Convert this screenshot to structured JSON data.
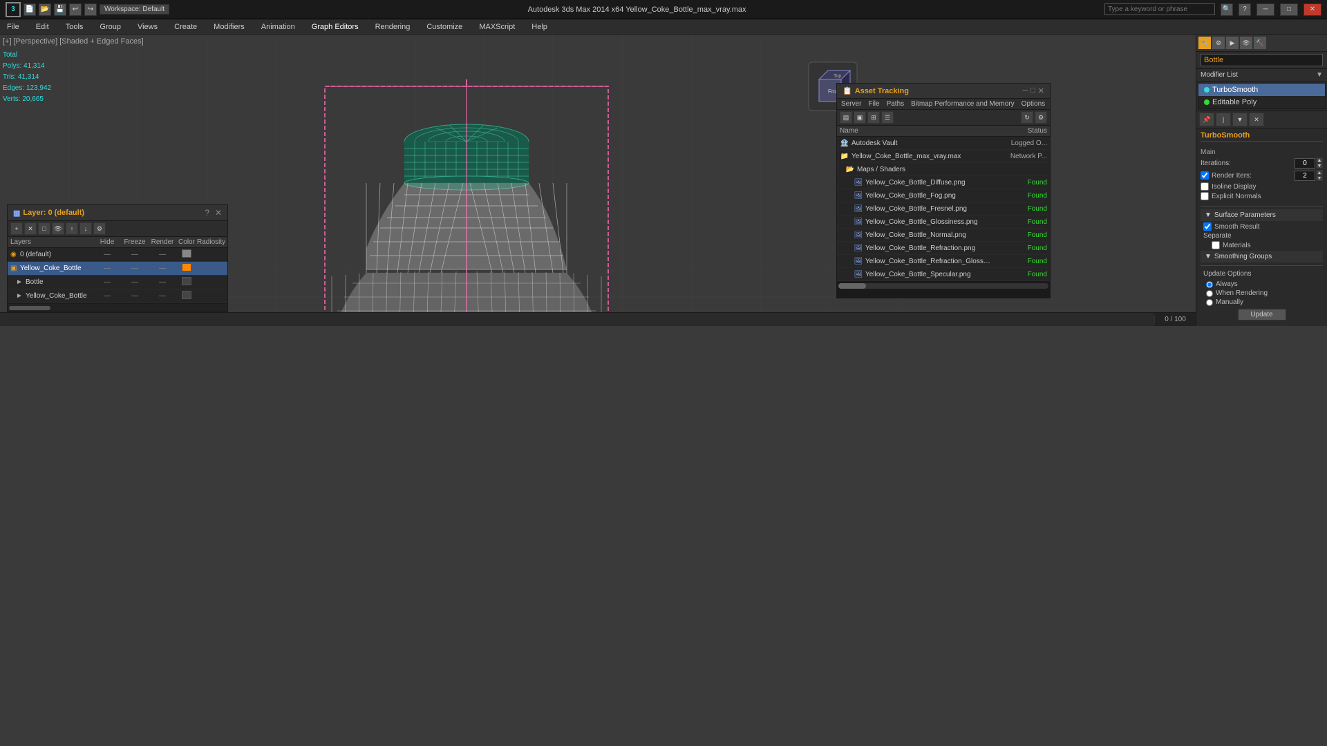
{
  "app": {
    "title": "Autodesk 3ds Max 2014 x64 — Yellow_Coke_Bottle_max_vray.max",
    "logo": "3",
    "workspace": "Workspace: Default"
  },
  "titlebar": {
    "undo": "↩",
    "redo": "↪",
    "window_title": "Autodesk 3ds Max 2014 x64   Yellow_Coke_Bottle_max_vray.max",
    "minimize": "─",
    "maximize": "□",
    "close": "✕"
  },
  "menubar": {
    "items": [
      "File",
      "Edit",
      "Tools",
      "Group",
      "Views",
      "Create",
      "Modifiers",
      "Animation",
      "Graph Editors",
      "Rendering",
      "Customize",
      "MAXScript",
      "Help"
    ]
  },
  "toolbar": {
    "workspace_label": "Workspace: Default"
  },
  "viewport": {
    "label": "[+] [Perspective] [Shaded + Edged Faces]",
    "stats": {
      "total_label": "Total",
      "polys_label": "Polys:",
      "polys_val": "41,314",
      "tris_label": "Tris:",
      "tris_val": "41,314",
      "edges_label": "Edges:",
      "edges_val": "123,942",
      "verts_label": "Verts:",
      "verts_val": "20,665"
    }
  },
  "modifier_panel": {
    "object_name": "Bottle",
    "modifier_list_label": "Modifier List",
    "modifiers": [
      {
        "name": "TurboSmooth",
        "selected": true
      },
      {
        "name": "Editable Poly",
        "selected": false
      }
    ],
    "turbosmooth": {
      "title": "TurboSmooth",
      "main_label": "Main",
      "iterations_label": "Iterations:",
      "iterations_val": "0",
      "render_iters_label": "Render Iters:",
      "render_iters_val": "2",
      "isoline_display_label": "Isoline Display",
      "isoline_display_checked": false,
      "explicit_normals_label": "Explicit Normals",
      "explicit_normals_checked": false,
      "surface_params_label": "Surface Parameters",
      "smooth_result_label": "Smooth Result",
      "smooth_result_checked": true,
      "separate_label": "Separate",
      "materials_label": "Materials",
      "materials_checked": false,
      "smoothing_groups_label": "Smoothing Groups",
      "smoothing_groups_checked": false,
      "update_options_label": "Update Options",
      "always_label": "Always",
      "always_checked": true,
      "when_rendering_label": "When Rendering",
      "when_rendering_checked": false,
      "manually_label": "Manually",
      "manually_checked": false,
      "update_btn": "Update"
    }
  },
  "layers": {
    "title": "Layer: 0 (default)",
    "panel_title": "Layers",
    "columns": [
      "Layers",
      "Hide",
      "Freeze",
      "Render",
      "Color",
      "Radiosity"
    ],
    "items": [
      {
        "indent": 0,
        "name": "0 (default)",
        "hide": "—",
        "freeze": "—",
        "render": "—",
        "color": "#888888",
        "selected": false
      },
      {
        "indent": 1,
        "name": "Yellow_Coke_Bottle",
        "hide": "—",
        "freeze": "—",
        "render": "—",
        "color": "#ff8800",
        "selected": true
      },
      {
        "indent": 2,
        "name": "Bottle",
        "hide": "—",
        "freeze": "—",
        "render": "—",
        "color": "#444444",
        "selected": false
      },
      {
        "indent": 2,
        "name": "Yellow_Coke_Bottle",
        "hide": "—",
        "freeze": "—",
        "render": "—",
        "color": "#444444",
        "selected": false
      }
    ]
  },
  "asset_tracking": {
    "title": "Asset Tracking",
    "menu": [
      "Server",
      "File",
      "Paths",
      "Bitmap Performance and Memory",
      "Options"
    ],
    "columns": [
      "Name",
      "Status"
    ],
    "items": [
      {
        "indent": 0,
        "type": "vault",
        "name": "Autodesk Vault",
        "status": "Logged O...",
        "status_type": "network"
      },
      {
        "indent": 0,
        "type": "file",
        "name": "Yellow_Coke_Bottle_max_vray.max",
        "status": "Network P...",
        "status_type": "network"
      },
      {
        "indent": 1,
        "type": "folder",
        "name": "Maps / Shaders",
        "status": "",
        "status_type": ""
      },
      {
        "indent": 2,
        "type": "img",
        "name": "Yellow_Coke_Bottle_Diffuse.png",
        "status": "Found",
        "status_type": "found"
      },
      {
        "indent": 2,
        "type": "img",
        "name": "Yellow_Coke_Bottle_Fog.png",
        "status": "Found",
        "status_type": "found"
      },
      {
        "indent": 2,
        "type": "img",
        "name": "Yellow_Coke_Bottle_Fresnel.png",
        "status": "Found",
        "status_type": "found"
      },
      {
        "indent": 2,
        "type": "img",
        "name": "Yellow_Coke_Bottle_Glossiness.png",
        "status": "Found",
        "status_type": "found"
      },
      {
        "indent": 2,
        "type": "img",
        "name": "Yellow_Coke_Bottle_Normal.png",
        "status": "Found",
        "status_type": "found"
      },
      {
        "indent": 2,
        "type": "img",
        "name": "Yellow_Coke_Bottle_Refraction.png",
        "status": "Found",
        "status_type": "found"
      },
      {
        "indent": 2,
        "type": "img",
        "name": "Yellow_Coke_Bottle_Refraction_Glossiness.png",
        "status": "Found",
        "status_type": "found"
      },
      {
        "indent": 2,
        "type": "img",
        "name": "Yellow_Coke_Bottle_Specular.png",
        "status": "Found",
        "status_type": "found"
      }
    ]
  }
}
